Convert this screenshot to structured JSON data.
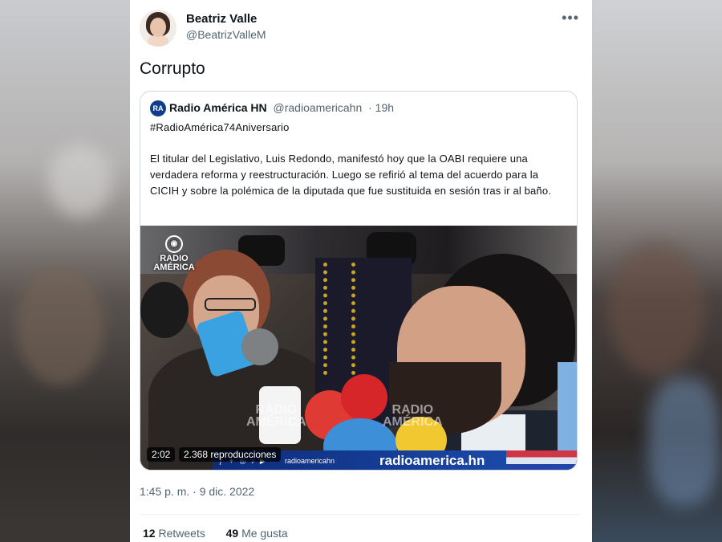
{
  "author": {
    "name": "Beatriz Valle",
    "handle": "@BeatrizValleM"
  },
  "tweet": {
    "text": "Corrupto",
    "timestamp": "1:45 p. m. · 9 dic. 2022",
    "retweets_count": "12",
    "retweets_label": "Retweets",
    "likes_count": "49",
    "likes_label": "Me gusta"
  },
  "quoted": {
    "name": "Radio América HN",
    "handle": "@radioamericahn",
    "age": "· 19h",
    "hashtag": "#RadioAmérica74Aniversario",
    "body": "El titular del Legislativo, Luis Redondo, manifestó hoy que la OABI requiere una verdadera reforma y reestructuración. Luego se refirió al tema del acuerdo para la CICIH y sobre la polémica de la diputada que fue sustituida en sesión tras ir al baño.",
    "video": {
      "duration": "2:02",
      "views": "2.368 reproducciones",
      "brand_line1": "RADIO",
      "brand_line2": "AMÉRICA",
      "bar_handle": "radioamericahn",
      "bar_site": "radioamerica.hn"
    }
  },
  "icons": {
    "more": "more-options-icon",
    "logo": "radio-america-logo"
  },
  "colors": {
    "text_primary": "#0f1419",
    "text_secondary": "#536471",
    "border": "#cfd9de",
    "brand_blue": "#0f3d8c"
  }
}
